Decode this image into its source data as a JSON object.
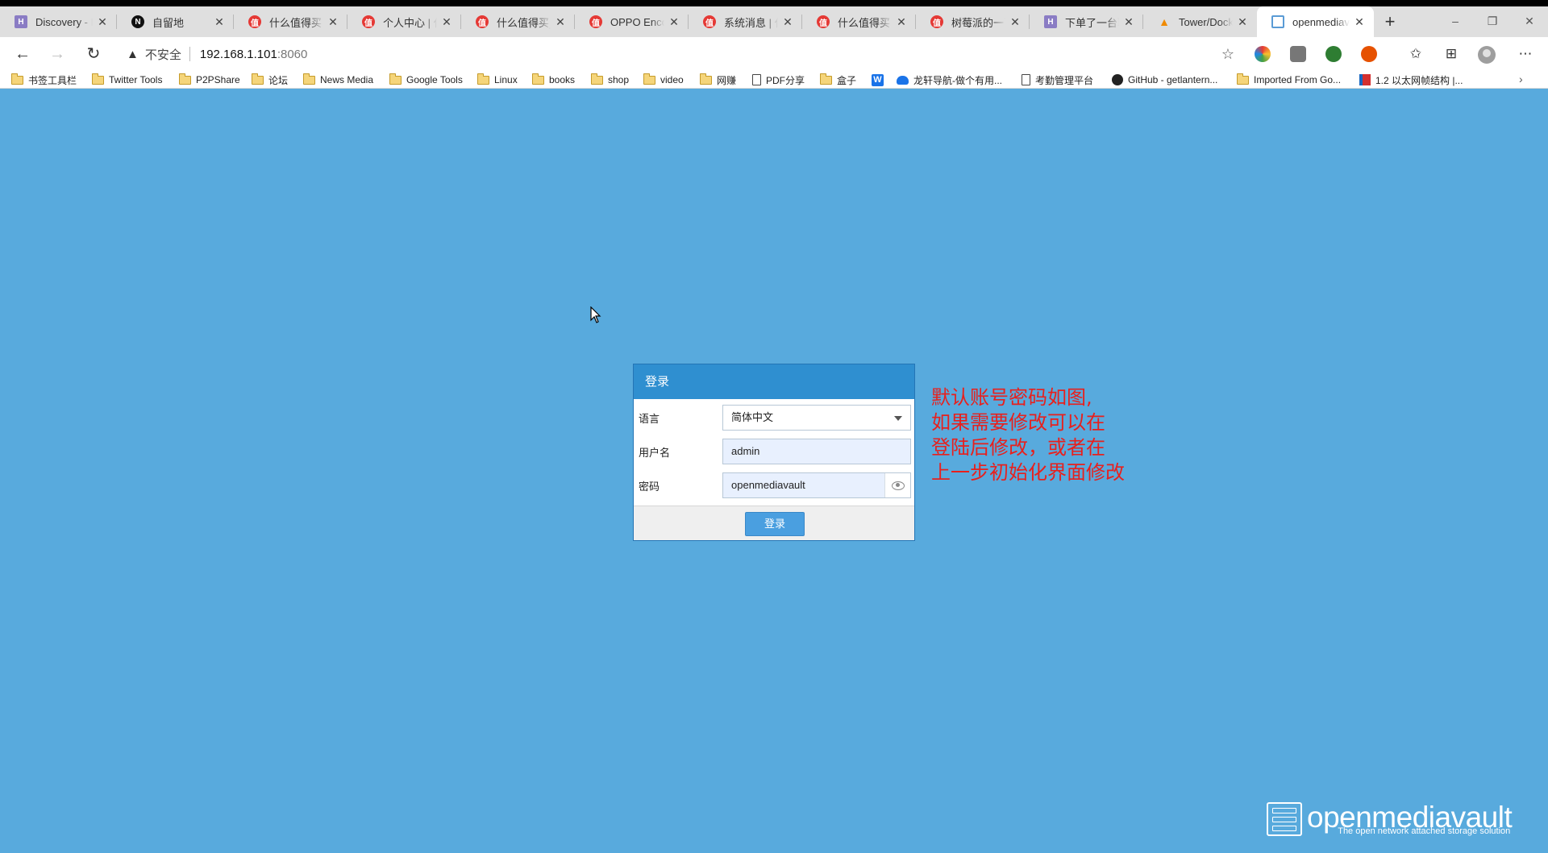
{
  "browser": {
    "tabs": [
      {
        "title": "Discovery - Hi",
        "icon": "hi-icon"
      },
      {
        "title": "自留地",
        "icon": "notion-icon"
      },
      {
        "title": "什么值得买 | 科",
        "icon": "zdm-icon"
      },
      {
        "title": "个人中心 | 什么",
        "icon": "zdm-icon"
      },
      {
        "title": "什么值得买_消",
        "icon": "zdm-icon"
      },
      {
        "title": "OPPO Enco X",
        "icon": "zdm-icon"
      },
      {
        "title": "系统消息 | 什么",
        "icon": "zdm-icon"
      },
      {
        "title": "什么值得买 | 科",
        "icon": "zdm-icon"
      },
      {
        "title": "树莓派的一百",
        "icon": "zdm-icon"
      },
      {
        "title": "下单了一台联",
        "icon": "hi-icon"
      },
      {
        "title": "Tower/Docker",
        "icon": "tower-icon"
      },
      {
        "title": "openmediavault",
        "icon": "omv-icon",
        "active": true
      }
    ],
    "new_tab": "+",
    "window_controls": {
      "minimize": "–",
      "restore": "❐",
      "close": "✕"
    },
    "address": {
      "security_label": "不安全",
      "host": "192.168.1.101",
      "port": ":8060"
    },
    "bookmarks": [
      {
        "label": "书签工具栏",
        "icon": "folder-icon"
      },
      {
        "label": "Twitter Tools",
        "icon": "folder-icon"
      },
      {
        "label": "P2PShare",
        "icon": "folder-icon"
      },
      {
        "label": "论坛",
        "icon": "folder-icon"
      },
      {
        "label": "News Media",
        "icon": "folder-icon"
      },
      {
        "label": "Google Tools",
        "icon": "folder-icon"
      },
      {
        "label": "Linux",
        "icon": "folder-icon"
      },
      {
        "label": "books",
        "icon": "folder-icon"
      },
      {
        "label": "shop",
        "icon": "folder-icon"
      },
      {
        "label": "video",
        "icon": "folder-icon"
      },
      {
        "label": "网赚",
        "icon": "folder-icon"
      },
      {
        "label": "PDF分享",
        "icon": "document-icon"
      },
      {
        "label": "盒子",
        "icon": "folder-icon"
      },
      {
        "label": "",
        "icon": "w-icon"
      },
      {
        "label": "龙轩导航-做个有用...",
        "icon": "cloud-icon"
      },
      {
        "label": "考勤管理平台",
        "icon": "document-icon"
      },
      {
        "label": "GitHub - getlantern...",
        "icon": "github-icon"
      },
      {
        "label": "Imported From Go...",
        "icon": "folder-icon"
      },
      {
        "label": "1.2 以太网帧结构 |...",
        "icon": "book-icon"
      }
    ]
  },
  "login": {
    "title": "登录",
    "language_label": "语言",
    "language_value": "简体中文",
    "username_label": "用户名",
    "username_value": "admin",
    "password_label": "密码",
    "password_value": "openmediavault",
    "submit_label": "登录"
  },
  "annotation": {
    "lines": [
      "默认账号密码如图,",
      "如果需要修改可以在",
      "登陆后修改，或者在",
      "上一步初始化界面修改"
    ],
    "color": "#e8201d"
  },
  "brand": {
    "name": "openmediavault",
    "tagline": "The open network attached storage solution"
  },
  "colors": {
    "background": "#58aadd",
    "login_header": "#2f8fd0",
    "login_button": "#4a9fe0"
  }
}
